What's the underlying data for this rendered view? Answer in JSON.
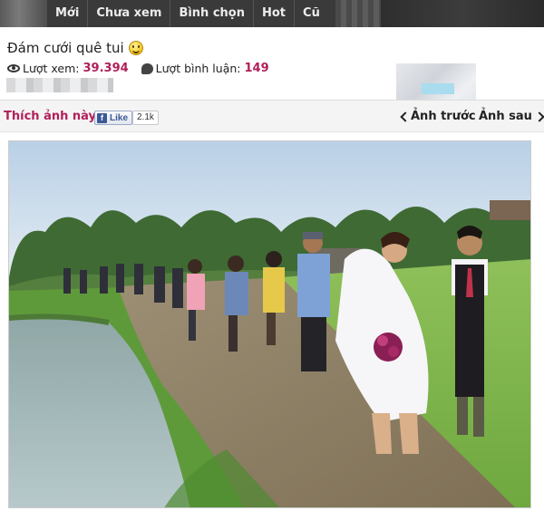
{
  "nav": {
    "items": [
      "Mới",
      "Chưa xem",
      "Bình chọn",
      "Hot",
      "Cũ"
    ]
  },
  "post": {
    "title": "Đám cưới quê tui",
    "views_label": "Lượt xem:",
    "views_value": "39.394",
    "comments_label": "Lượt bình luận:",
    "comments_value": "149"
  },
  "likebar": {
    "prompt": "Thích ảnh này?",
    "like_button": "Like",
    "like_count": "2.1k",
    "prev_label": "Ảnh trước",
    "next_label": "Ảnh sau"
  },
  "colors": {
    "accent": "#b0205a",
    "nav_bg": "#3a3a3a",
    "facebook": "#3b5998"
  },
  "icons": {
    "views": "eye-icon",
    "comments": "comment-icon",
    "emoji": "smiley-icon",
    "prev": "chevron-left-icon",
    "next": "chevron-right-icon"
  }
}
